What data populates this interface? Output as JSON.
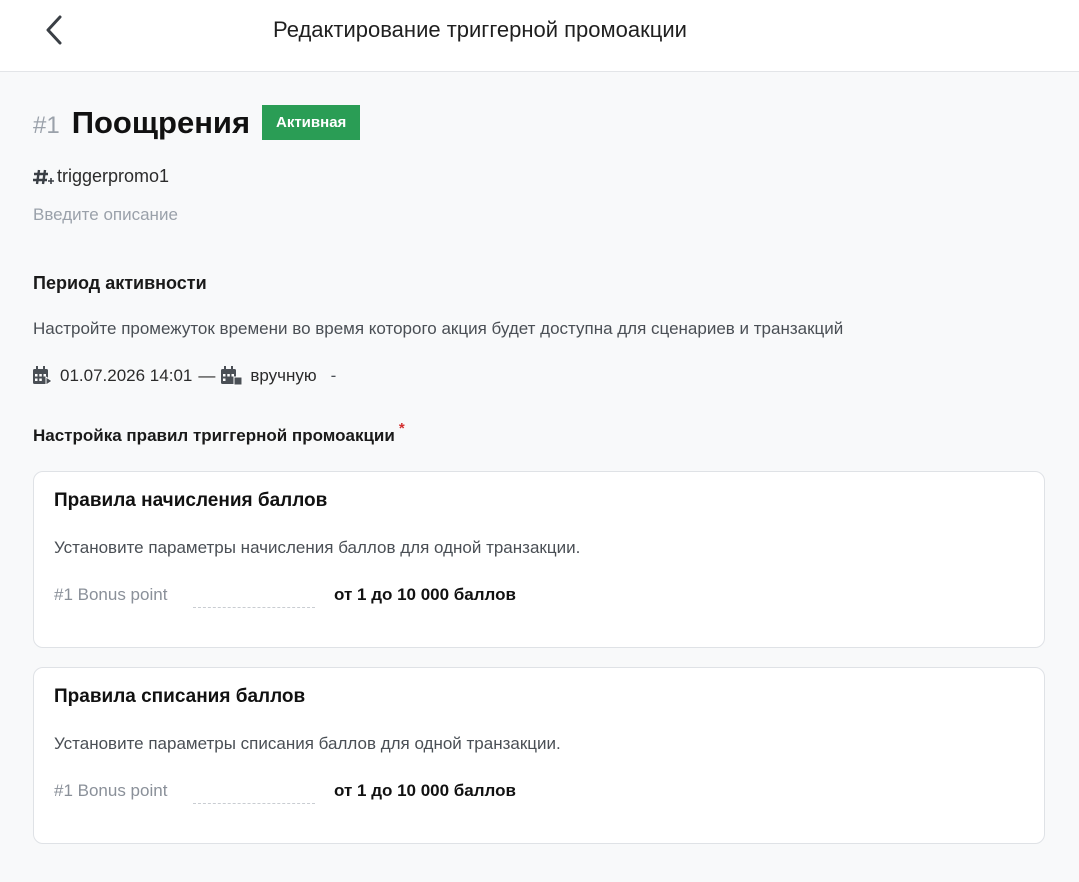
{
  "header": {
    "title": "Редактирование триггерной промоакции",
    "back_icon": "chevron-left-icon"
  },
  "promo": {
    "number": "#1",
    "name": "Поощрения",
    "status": "Активная",
    "status_color": "#2a9d55",
    "tag": "triggerpromo1",
    "tag_icon": "hashtag-icon",
    "description_placeholder": "Введите описание",
    "description_value": ""
  },
  "period": {
    "title": "Период активности",
    "description": "Настройте промежуток времени во время которого акция будет доступна для сценариев и транзакций",
    "start": "01.07.2026 14:01",
    "separator": "—",
    "end": "вручную",
    "end_suffix": "-",
    "start_icon": "calendar-start-icon",
    "end_icon": "calendar-end-icon"
  },
  "rules": {
    "title": "Настройка правил триггерной промоакции",
    "required_mark": "*",
    "accrual": {
      "title": "Правила начисления баллов",
      "description": "Установите параметры начисления баллов для одной транзакции.",
      "field_label": "#1 Bonus point",
      "field_value": "",
      "range": "от 1 до 10 000 баллов"
    },
    "writeoff": {
      "title": "Правила списания баллов",
      "description": "Установите параметры списания баллов для одной транзакции.",
      "field_label": "#1 Bonus point",
      "field_value": "",
      "range": "от 1 до 10 000 баллов"
    }
  }
}
